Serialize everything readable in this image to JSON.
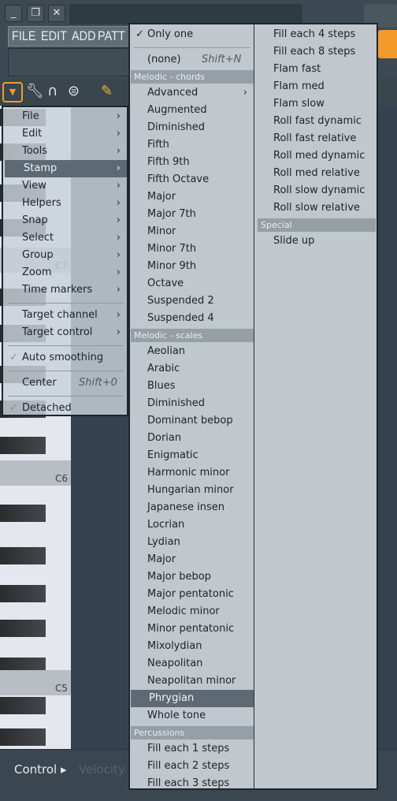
{
  "window": {
    "buttons": [
      "_",
      "❐",
      "✕"
    ],
    "menubar": [
      "FILE",
      "EDIT",
      "ADD",
      "PATT"
    ]
  },
  "toolbar": {
    "icons": [
      "dropdown-icon",
      "wrench-icon",
      "magnet-icon",
      "menu-circle-icon",
      "pencil-icon"
    ]
  },
  "piano": {
    "octaves": [
      "C7",
      "C6",
      "C5"
    ]
  },
  "bottom": {
    "control": "Control ▸",
    "velocity": "Velocity"
  },
  "left_menu": {
    "items": [
      {
        "label": "File",
        "arrow": true
      },
      {
        "label": "Edit",
        "arrow": true
      },
      {
        "label": "Tools",
        "arrow": true
      },
      {
        "label": "Stamp",
        "arrow": true,
        "selected": true
      },
      {
        "label": "View",
        "arrow": true
      },
      {
        "label": "Helpers",
        "arrow": true
      },
      {
        "label": "Snap",
        "arrow": true
      },
      {
        "label": "Select",
        "arrow": true
      },
      {
        "label": "Group",
        "arrow": true
      },
      {
        "label": "Zoom",
        "arrow": true
      },
      {
        "label": "Time markers",
        "arrow": true
      },
      {
        "sep": true
      },
      {
        "label": "Target channel",
        "arrow": true
      },
      {
        "label": "Target control",
        "arrow": true
      },
      {
        "sep": true
      },
      {
        "label": "Auto smoothing",
        "checked": true
      },
      {
        "sep": true
      },
      {
        "label": "Center",
        "shortcut": "Shift+0"
      },
      {
        "sep": true
      },
      {
        "label": "Detached",
        "checked": true
      }
    ]
  },
  "stamp_menu": {
    "left": [
      {
        "label": "Only one",
        "checked": true
      },
      {
        "sep": true
      },
      {
        "label": "(none)",
        "shortcut": "Shift+N"
      },
      {
        "header": "Melodic - chords"
      },
      {
        "label": "Advanced",
        "arrow": true
      },
      {
        "label": "Augmented"
      },
      {
        "label": "Diminished"
      },
      {
        "label": "Fifth"
      },
      {
        "label": "Fifth 9th"
      },
      {
        "label": "Fifth Octave"
      },
      {
        "label": "Major"
      },
      {
        "label": "Major 7th"
      },
      {
        "label": "Minor"
      },
      {
        "label": "Minor 7th"
      },
      {
        "label": "Minor 9th"
      },
      {
        "label": "Octave"
      },
      {
        "label": "Suspended 2"
      },
      {
        "label": "Suspended 4"
      },
      {
        "header": "Melodic - scales"
      },
      {
        "label": "Aeolian"
      },
      {
        "label": "Arabic"
      },
      {
        "label": "Blues"
      },
      {
        "label": "Diminished"
      },
      {
        "label": "Dominant bebop"
      },
      {
        "label": "Dorian"
      },
      {
        "label": "Enigmatic"
      },
      {
        "label": "Harmonic minor"
      },
      {
        "label": "Hungarian minor"
      },
      {
        "label": "Japanese insen"
      },
      {
        "label": "Locrian"
      },
      {
        "label": "Lydian"
      },
      {
        "label": "Major"
      },
      {
        "label": "Major bebop"
      },
      {
        "label": "Major pentatonic"
      },
      {
        "label": "Melodic minor"
      },
      {
        "label": "Minor pentatonic"
      },
      {
        "label": "Mixolydian"
      },
      {
        "label": "Neapolitan"
      },
      {
        "label": "Neapolitan minor"
      },
      {
        "label": "Phrygian",
        "selected": true
      },
      {
        "label": "Whole tone"
      },
      {
        "header": "Percussions"
      },
      {
        "label": "Fill each 1 steps"
      },
      {
        "label": "Fill each 2 steps"
      },
      {
        "label": "Fill each 3 steps"
      }
    ],
    "right": [
      {
        "label": "Fill each 4 steps"
      },
      {
        "label": "Fill each 8 steps"
      },
      {
        "label": "Flam fast"
      },
      {
        "label": "Flam med"
      },
      {
        "label": "Flam slow"
      },
      {
        "label": "Roll fast dynamic"
      },
      {
        "label": "Roll fast relative"
      },
      {
        "label": "Roll med dynamic"
      },
      {
        "label": "Roll med relative"
      },
      {
        "label": "Roll slow dynamic"
      },
      {
        "label": "Roll slow relative"
      },
      {
        "header": "Special"
      },
      {
        "label": "Slide up"
      }
    ]
  },
  "colors": {
    "accent": "#f39a2b",
    "menu_bg": "#c0c7cd",
    "selected": "#5d6a74",
    "header": "#959fa6"
  }
}
